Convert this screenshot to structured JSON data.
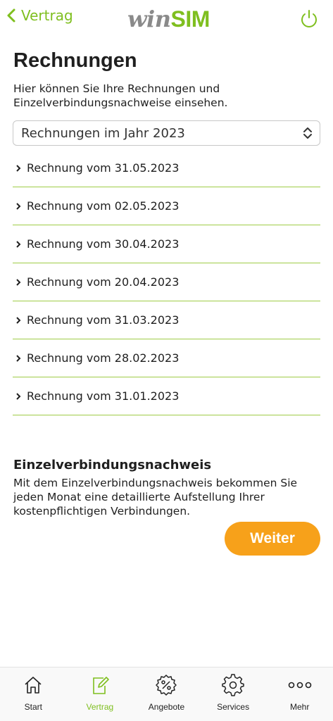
{
  "header": {
    "back_label": "Vertrag",
    "logo_win": "win",
    "logo_sim": "SIM"
  },
  "page": {
    "title": "Rechnungen",
    "description": "Hier können Sie Ihre Rechnungen und Einzelverbindungsnachweise einsehen."
  },
  "year_select": {
    "value": "Rechnungen im Jahr 2023"
  },
  "invoices": [
    "Rechnung vom 31.05.2023",
    "Rechnung vom 02.05.2023",
    "Rechnung vom 30.04.2023",
    "Rechnung vom 20.04.2023",
    "Rechnung vom 31.03.2023",
    "Rechnung vom 28.02.2023",
    "Rechnung vom 31.01.2023"
  ],
  "evn": {
    "title": "Einzelverbindungsnachweis",
    "text": "Mit dem Einzelverbindungsnachweis bekommen Sie jeden Monat eine detaillierte Aufstellung Ihrer kostenpflichtigen Verbindungen.",
    "button_label": "Weiter"
  },
  "tabbar": {
    "tabs": [
      {
        "label": "Start",
        "icon": "home-icon",
        "active": false
      },
      {
        "label": "Vertrag",
        "icon": "contract-edit-icon",
        "active": true
      },
      {
        "label": "Angebote",
        "icon": "percent-badge-icon",
        "active": false
      },
      {
        "label": "Services",
        "icon": "gear-icon",
        "active": false
      },
      {
        "label": "Mehr",
        "icon": "more-dots-icon",
        "active": false
      }
    ]
  },
  "colors": {
    "accent_green": "#7fbf1f",
    "button_orange": "#f7a11a",
    "divider_green": "#9fcc47"
  }
}
